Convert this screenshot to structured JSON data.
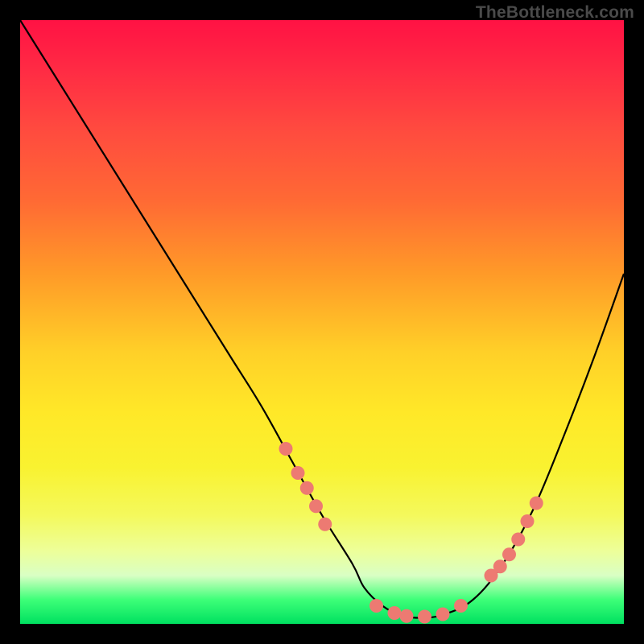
{
  "watermark": "TheBottleneck.com",
  "chart_data": {
    "type": "line",
    "title": "",
    "xlabel": "",
    "ylabel": "",
    "xlim": [
      0,
      100
    ],
    "ylim": [
      0,
      100
    ],
    "series": [
      {
        "name": "curve",
        "x": [
          0,
          5,
          10,
          15,
          20,
          25,
          30,
          35,
          40,
          45,
          50,
          55,
          57,
          60,
          63,
          66,
          70,
          75,
          80,
          85,
          90,
          95,
          100
        ],
        "y": [
          100,
          92,
          84,
          76,
          68,
          60,
          52,
          44,
          36,
          27,
          18,
          10,
          6,
          3,
          1.5,
          1,
          1.5,
          4,
          10,
          19,
          31,
          44,
          58
        ]
      }
    ],
    "markers": {
      "name": "highlight-dots",
      "color": "#ed7a72",
      "points": [
        {
          "x": 44,
          "y": 29
        },
        {
          "x": 46,
          "y": 25
        },
        {
          "x": 47.5,
          "y": 22.5
        },
        {
          "x": 49,
          "y": 19.5
        },
        {
          "x": 50.5,
          "y": 16.5
        },
        {
          "x": 59,
          "y": 3
        },
        {
          "x": 62,
          "y": 1.8
        },
        {
          "x": 64,
          "y": 1.3
        },
        {
          "x": 67,
          "y": 1.2
        },
        {
          "x": 70,
          "y": 1.6
        },
        {
          "x": 73,
          "y": 3
        },
        {
          "x": 78,
          "y": 8
        },
        {
          "x": 79.5,
          "y": 9.5
        },
        {
          "x": 81,
          "y": 11.5
        },
        {
          "x": 82.5,
          "y": 14
        },
        {
          "x": 84,
          "y": 17
        },
        {
          "x": 85.5,
          "y": 20
        }
      ]
    },
    "gradient_stops": [
      {
        "pos": 0,
        "color": "#ff1244"
      },
      {
        "pos": 8,
        "color": "#ff2a44"
      },
      {
        "pos": 18,
        "color": "#ff4a3f"
      },
      {
        "pos": 30,
        "color": "#ff6a34"
      },
      {
        "pos": 42,
        "color": "#ff9a28"
      },
      {
        "pos": 55,
        "color": "#ffd028"
      },
      {
        "pos": 65,
        "color": "#ffe828"
      },
      {
        "pos": 74,
        "color": "#f9f230"
      },
      {
        "pos": 82,
        "color": "#f4f95c"
      },
      {
        "pos": 88,
        "color": "#edff9a"
      },
      {
        "pos": 92,
        "color": "#d9ffc4"
      },
      {
        "pos": 96,
        "color": "#3dff78"
      },
      {
        "pos": 100,
        "color": "#00e060"
      }
    ]
  }
}
